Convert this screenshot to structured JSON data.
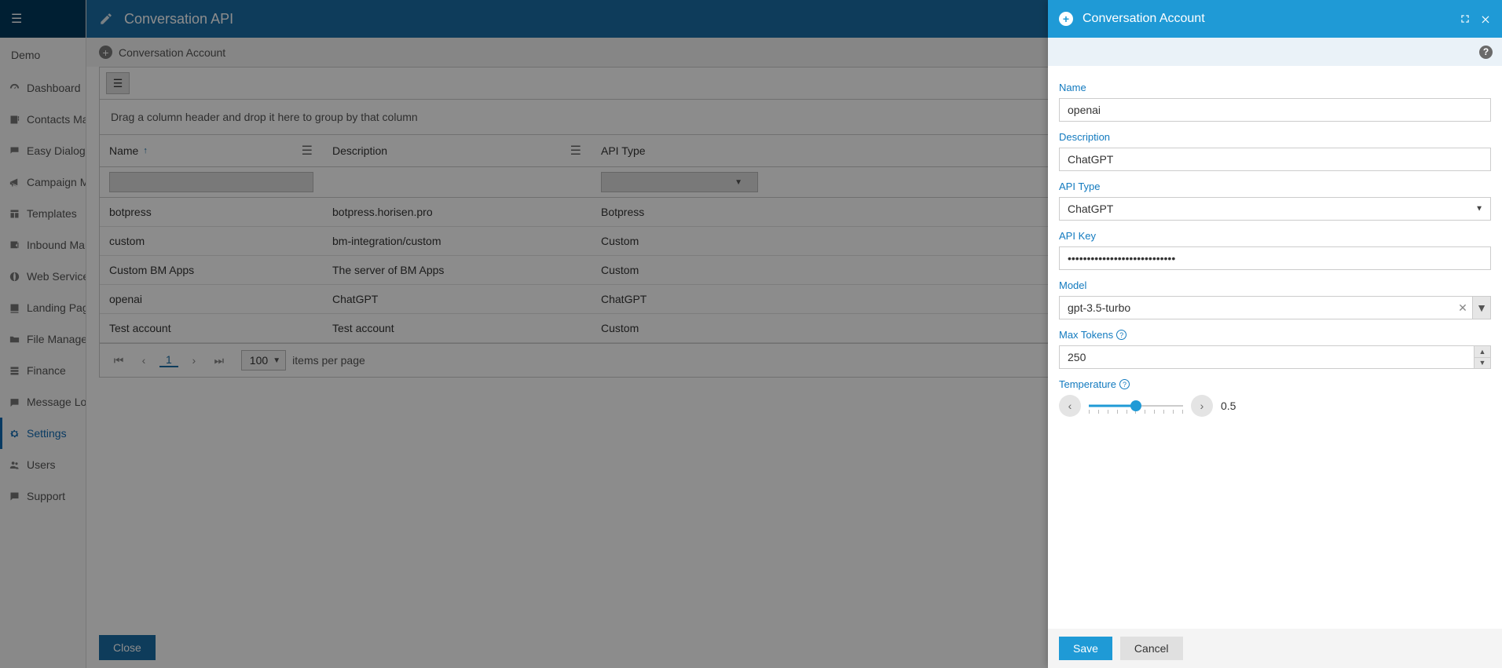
{
  "sidebar": {
    "context": "Demo",
    "items": [
      {
        "label": "Dashboard",
        "icon": "dashboard-icon"
      },
      {
        "label": "Contacts Manager",
        "icon": "contacts-icon"
      },
      {
        "label": "Easy Dialog",
        "icon": "dialog-icon"
      },
      {
        "label": "Campaign Manager",
        "icon": "campaign-icon"
      },
      {
        "label": "Templates",
        "icon": "templates-icon"
      },
      {
        "label": "Inbound Manager",
        "icon": "inbound-icon"
      },
      {
        "label": "Web Services",
        "icon": "webservices-icon"
      },
      {
        "label": "Landing Pages",
        "icon": "landing-icon"
      },
      {
        "label": "File Manager",
        "icon": "file-icon"
      },
      {
        "label": "Finance",
        "icon": "finance-icon"
      },
      {
        "label": "Message Log",
        "icon": "messagelog-icon"
      },
      {
        "label": "Settings",
        "icon": "settings-icon",
        "active": true
      },
      {
        "label": "Users",
        "icon": "users-icon"
      },
      {
        "label": "Support",
        "icon": "support-icon"
      }
    ]
  },
  "main": {
    "title": "Conversation API",
    "add_label": "Conversation Account",
    "group_hint": "Drag a column header and drop it here to group by that column",
    "columns": {
      "name": "Name",
      "description": "Description",
      "api_type": "API Type"
    },
    "rows": [
      {
        "name": "botpress",
        "description": "botpress.horisen.pro",
        "type": "Botpress"
      },
      {
        "name": "custom",
        "description": "bm-integration/custom",
        "type": "Custom"
      },
      {
        "name": "Custom BM Apps",
        "description": "The server of BM Apps",
        "type": "Custom"
      },
      {
        "name": "openai",
        "description": "ChatGPT",
        "type": "ChatGPT"
      },
      {
        "name": "Test account",
        "description": "Test account",
        "type": "Custom"
      }
    ],
    "pager": {
      "page": "1",
      "page_size": "100",
      "items_per_page": "items per page"
    },
    "close": "Close"
  },
  "panel": {
    "title": "Conversation Account",
    "labels": {
      "name": "Name",
      "description": "Description",
      "api_type": "API Type",
      "api_key": "API Key",
      "model": "Model",
      "max_tokens": "Max Tokens",
      "temperature": "Temperature"
    },
    "values": {
      "name": "openai",
      "description": "ChatGPT",
      "api_type": "ChatGPT",
      "api_key": "••••••••••••••••••••••••••••",
      "model": "gpt-3.5-turbo",
      "max_tokens": "250",
      "temperature": "0.5"
    },
    "buttons": {
      "save": "Save",
      "cancel": "Cancel"
    }
  }
}
